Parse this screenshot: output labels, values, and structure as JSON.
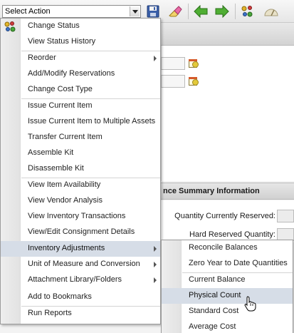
{
  "toolbar": {
    "select_action": {
      "value": "Select Action"
    },
    "icons": [
      "save-icon",
      "clear-icon",
      "back-arrow-icon",
      "forward-arrow-icon",
      "hierarchy-icon",
      "dashboard-gauge-icon"
    ]
  },
  "background": {
    "section_title": "nce Summary Information",
    "fields": {
      "quantity_currently_reserved": "Quantity Currently Reserved:",
      "hard_reserved_quantity": "Hard Reserved Quantity:"
    }
  },
  "action_menu": {
    "items": [
      {
        "label": "Change Status",
        "has_icon": true
      },
      {
        "label": "View Status History"
      },
      {
        "label": "Reorder",
        "submenu": true
      },
      {
        "label": "Add/Modify Reservations"
      },
      {
        "label": "Change Cost Type"
      },
      {
        "label": "Issue Current Item"
      },
      {
        "label": "Issue Current Item to Multiple Assets"
      },
      {
        "label": "Transfer Current Item"
      },
      {
        "label": "Assemble Kit"
      },
      {
        "label": "Disassemble Kit"
      },
      {
        "label": "View Item Availability"
      },
      {
        "label": "View Vendor Analysis"
      },
      {
        "label": "View Inventory Transactions"
      },
      {
        "label": "View/Edit Consignment Details"
      },
      {
        "label": "Inventory Adjustments",
        "submenu": true,
        "active": true
      },
      {
        "label": "Unit of Measure and Conversion",
        "submenu": true
      },
      {
        "label": "Attachment Library/Folders",
        "submenu": true
      },
      {
        "label": "Add to Bookmarks"
      },
      {
        "label": "Run Reports"
      }
    ]
  },
  "inventory_adjustments_submenu": {
    "items": [
      {
        "label": "Reconcile Balances"
      },
      {
        "label": "Zero Year to Date Quantities"
      },
      {
        "label": "Current Balance"
      },
      {
        "label": "Physical Count",
        "hovered": true
      },
      {
        "label": "Standard Cost"
      },
      {
        "label": "Average Cost"
      }
    ]
  },
  "colors": {
    "menu_hover": "#d6dde7",
    "menu_gutter": "#e8e8e8",
    "menu_border": "#9c9c9c",
    "arrow_green": "#3f9b2a"
  }
}
